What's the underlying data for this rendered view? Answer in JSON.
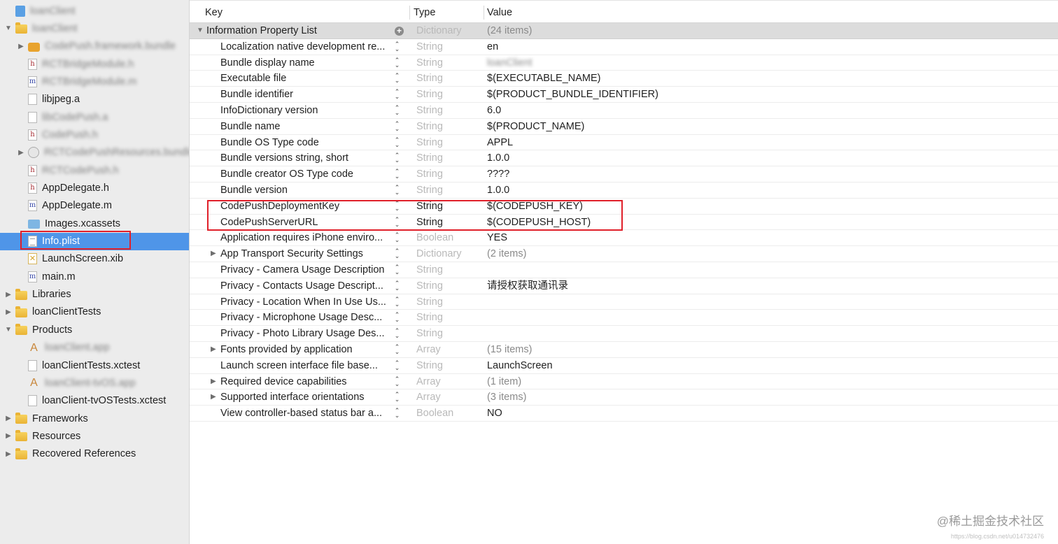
{
  "sidebar": {
    "items": [
      {
        "label": "loanClient",
        "icon": "project-icon",
        "disclosure": "",
        "blur": true
      },
      {
        "label": "loanClient",
        "icon": "folder-icon",
        "disclosure": "▼",
        "blur": true
      },
      {
        "label": "CodePush.framework.bundle",
        "icon": "briefcase-icon",
        "disclosure": "▶",
        "blur": true
      },
      {
        "label": "RCTBridgeModule.h",
        "icon": "header-file-icon",
        "disclosure": "",
        "blur": true
      },
      {
        "label": "RCTBridgeModule.m",
        "icon": "source-file-icon",
        "disclosure": "",
        "blur": true
      },
      {
        "label": "libjpeg.a",
        "icon": "file-icon",
        "disclosure": "",
        "blur": false
      },
      {
        "label": "libCodePush.a",
        "icon": "file-icon",
        "disclosure": "",
        "blur": true
      },
      {
        "label": "CodePush.h",
        "icon": "header-file-icon",
        "disclosure": "",
        "blur": true
      },
      {
        "label": "RCTCodePushResources.bundle",
        "icon": "bundle-icon",
        "disclosure": "▶",
        "blur": true
      },
      {
        "label": "RCTCodePush.h",
        "icon": "header-file-icon",
        "disclosure": "",
        "blur": true
      },
      {
        "label": "AppDelegate.h",
        "icon": "header-file-icon",
        "disclosure": "",
        "blur": false
      },
      {
        "label": "AppDelegate.m",
        "icon": "source-file-icon",
        "disclosure": "",
        "blur": false
      },
      {
        "label": "Images.xcassets",
        "icon": "asset-catalog-icon",
        "disclosure": "",
        "blur": false
      },
      {
        "label": "Info.plist",
        "icon": "plist-file-icon",
        "disclosure": "",
        "blur": false,
        "selected": true
      },
      {
        "label": "LaunchScreen.xib",
        "icon": "xib-file-icon",
        "disclosure": "",
        "blur": false
      },
      {
        "label": "main.m",
        "icon": "source-file-icon",
        "disclosure": "",
        "blur": false
      },
      {
        "label": "Libraries",
        "icon": "folder-icon",
        "disclosure": "▶",
        "blur": false
      },
      {
        "label": "loanClientTests",
        "icon": "folder-icon",
        "disclosure": "▶",
        "blur": false
      },
      {
        "label": "Products",
        "icon": "folder-icon",
        "disclosure": "▼",
        "blur": false
      },
      {
        "label": "loanClient.app",
        "icon": "app-icon",
        "disclosure": "",
        "blur": true
      },
      {
        "label": "loanClientTests.xctest",
        "icon": "file-icon",
        "disclosure": "",
        "blur": false
      },
      {
        "label": "loanClient-tvOS.app",
        "icon": "app-icon",
        "disclosure": "",
        "blur": true
      },
      {
        "label": "loanClient-tvOSTests.xctest",
        "icon": "file-icon",
        "disclosure": "",
        "blur": false
      },
      {
        "label": "Frameworks",
        "icon": "folder-icon",
        "disclosure": "▶",
        "blur": false
      },
      {
        "label": "Resources",
        "icon": "folder-icon",
        "disclosure": "▶",
        "blur": false
      },
      {
        "label": "Recovered References",
        "icon": "folder-icon",
        "disclosure": "▶",
        "blur": false
      }
    ]
  },
  "table": {
    "headers": {
      "key": "Key",
      "type": "Type",
      "value": "Value"
    },
    "rows": [
      {
        "key": "Information Property List",
        "type": "Dictionary",
        "value": "(24 items)",
        "root": true,
        "disclosure": "▼"
      },
      {
        "key": "Localization native development re...",
        "type": "String",
        "value": "en"
      },
      {
        "key": "Bundle display name",
        "type": "String",
        "value": "loanClient",
        "blurValue": true
      },
      {
        "key": "Executable file",
        "type": "String",
        "value": "$(EXECUTABLE_NAME)"
      },
      {
        "key": "Bundle identifier",
        "type": "String",
        "value": "$(PRODUCT_BUNDLE_IDENTIFIER)"
      },
      {
        "key": "InfoDictionary version",
        "type": "String",
        "value": "6.0"
      },
      {
        "key": "Bundle name",
        "type": "String",
        "value": "$(PRODUCT_NAME)"
      },
      {
        "key": "Bundle OS Type code",
        "type": "String",
        "value": "APPL"
      },
      {
        "key": "Bundle versions string, short",
        "type": "String",
        "value": "1.0.0"
      },
      {
        "key": "Bundle creator OS Type code",
        "type": "String",
        "value": "????"
      },
      {
        "key": "Bundle version",
        "type": "String",
        "value": "1.0.0"
      },
      {
        "key": "CodePushDeploymentKey",
        "type": "String",
        "value": "$(CODEPUSH_KEY)",
        "darkType": true
      },
      {
        "key": "CodePushServerURL",
        "type": "String",
        "value": "$(CODEPUSH_HOST)",
        "darkType": true
      },
      {
        "key": "Application requires iPhone enviro...",
        "type": "Boolean",
        "value": "YES"
      },
      {
        "key": "App Transport Security Settings",
        "type": "Dictionary",
        "value": "(2 items)",
        "disclosure": "▶"
      },
      {
        "key": "Privacy - Camera Usage Description",
        "type": "String",
        "value": ""
      },
      {
        "key": "Privacy - Contacts Usage Descript...",
        "type": "String",
        "value": "请授权获取通讯录"
      },
      {
        "key": "Privacy - Location When In Use Us...",
        "type": "String",
        "value": ""
      },
      {
        "key": "Privacy - Microphone Usage Desc...",
        "type": "String",
        "value": ""
      },
      {
        "key": "Privacy - Photo Library Usage Des...",
        "type": "String",
        "value": ""
      },
      {
        "key": "Fonts provided by application",
        "type": "Array",
        "value": "(15 items)",
        "disclosure": "▶"
      },
      {
        "key": "Launch screen interface file base...",
        "type": "String",
        "value": "LaunchScreen"
      },
      {
        "key": "Required device capabilities",
        "type": "Array",
        "value": "(1 item)",
        "disclosure": "▶"
      },
      {
        "key": "Supported interface orientations",
        "type": "Array",
        "value": "(3 items)",
        "disclosure": "▶"
      },
      {
        "key": "View controller-based status bar a...",
        "type": "Boolean",
        "value": "NO"
      }
    ]
  },
  "watermark": {
    "text": "@稀土掘金技术社区",
    "small": "https://blog.csdn.net/u014732476"
  }
}
